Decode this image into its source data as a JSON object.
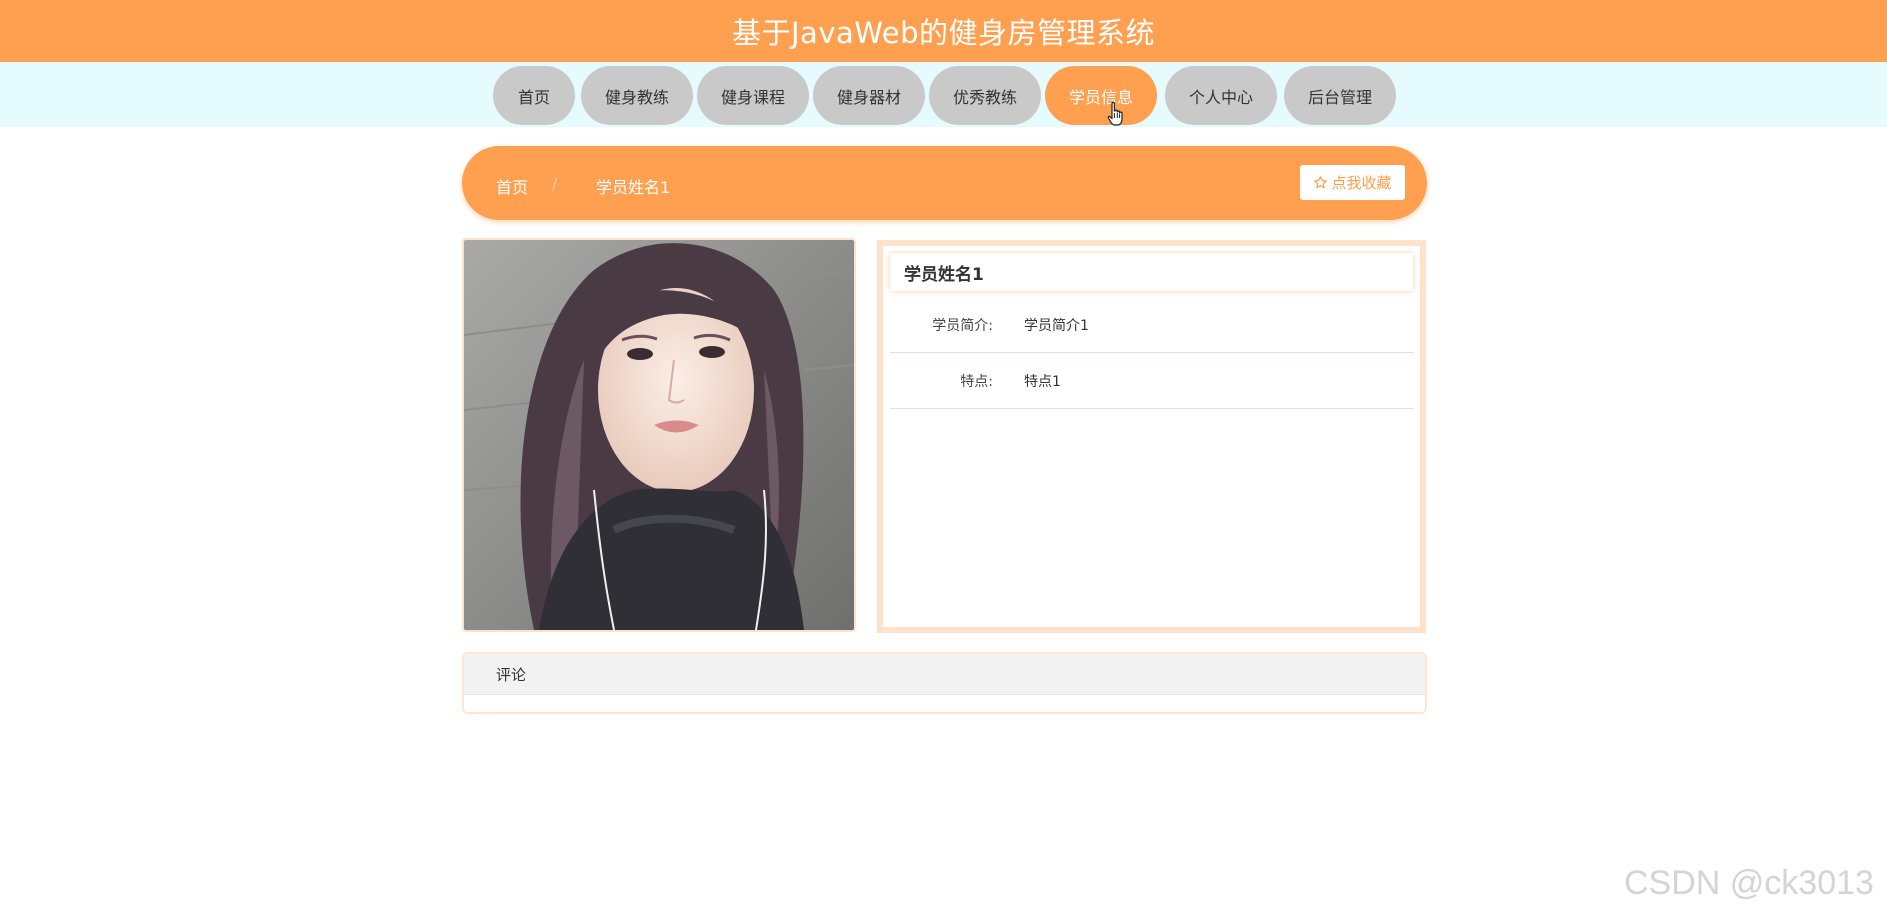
{
  "header": {
    "title": "基于JavaWeb的健身房管理系统"
  },
  "nav": {
    "items": [
      {
        "label": "首页",
        "active": false
      },
      {
        "label": "健身教练",
        "active": false
      },
      {
        "label": "健身课程",
        "active": false
      },
      {
        "label": "健身器材",
        "active": false
      },
      {
        "label": "优秀教练",
        "active": false
      },
      {
        "label": "学员信息",
        "active": true
      },
      {
        "label": "个人中心",
        "active": false
      },
      {
        "label": "后台管理",
        "active": false
      }
    ]
  },
  "breadcrumb": {
    "home": "首页",
    "separator": "/",
    "current": "学员姓名1"
  },
  "favorite": {
    "label": "点我收藏",
    "icon": "star-outline-icon"
  },
  "student": {
    "name": "学员姓名1",
    "photo_icon": "student-photo",
    "fields": [
      {
        "label": "学员简介:",
        "value": "学员简介1"
      },
      {
        "label": "特点:",
        "value": "特点1"
      }
    ]
  },
  "comments": {
    "title": "评论"
  },
  "watermark": "CSDN @ck3013",
  "colors": {
    "accent": "#ffa050",
    "nav_bg": "#e6fbfd",
    "nav_item": "#c9c9c9"
  }
}
